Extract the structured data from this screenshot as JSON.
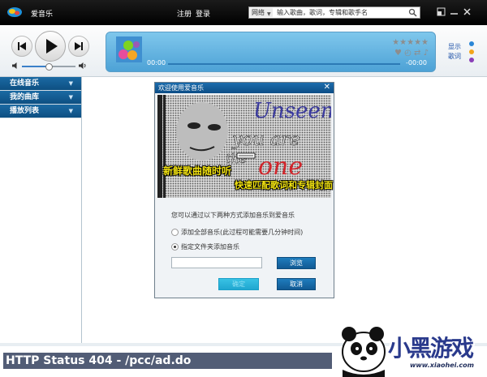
{
  "app": {
    "name": "爱音乐"
  },
  "header": {
    "register": "注册",
    "login": "登录",
    "search": {
      "category": "网络",
      "placeholder": "输入歌曲，歌词，专辑和歌手名"
    }
  },
  "player": {
    "time_start": "00:00",
    "time_end": "-00:00",
    "stars": "★★★★★",
    "controls": "♥ ◴ ⇄ ♪",
    "show_label": "显示",
    "lyrics_label": "歌词",
    "volume_level": 0.5,
    "progress_level": 0
  },
  "colors": {
    "accent": "#0d4f82",
    "display": "#5aafdd",
    "error_bar": "#525d76"
  },
  "sidebar": {
    "items": [
      {
        "label": "在线音乐"
      },
      {
        "label": "我的曲库"
      },
      {
        "label": "播放列表"
      }
    ]
  },
  "dialog": {
    "title": "欢迎使用爱音乐",
    "banner_lines": [
      "新鲜歌曲随时听",
      "快速匹配歌词和专辑封面"
    ],
    "banner_art_text": "Unseen you are the one",
    "intro": "您可以通过以下两种方式添加音乐到爱音乐",
    "option1": "添加全部音乐(此过程可能需要几分钟时间)",
    "option2": "指定文件夹添加音乐",
    "browse": "浏览",
    "confirm": "确定",
    "cancel": "取消",
    "folder_value": ""
  },
  "status": {
    "error": "HTTP Status 404 - /pcc/ad.do"
  },
  "watermark": {
    "text": "小黑游戏",
    "url": "www.xiaohei.com"
  }
}
